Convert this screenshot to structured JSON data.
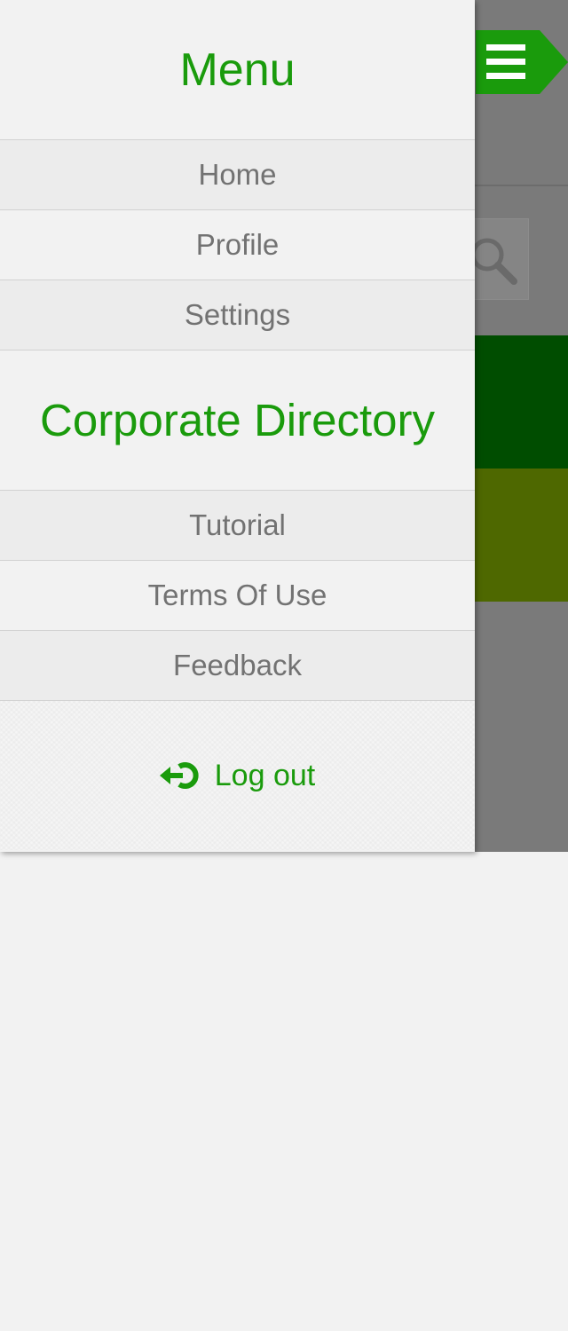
{
  "menu": {
    "title": "Menu",
    "items_top": [
      {
        "label": "Home"
      },
      {
        "label": "Profile"
      },
      {
        "label": "Settings"
      }
    ],
    "section_heading": "Corporate Directory",
    "items_bottom": [
      {
        "label": "Tutorial"
      },
      {
        "label": "Terms Of Use"
      },
      {
        "label": "Feedback"
      }
    ],
    "logout": {
      "label": "Log out",
      "icon": "logout-icon"
    }
  },
  "background_app": {
    "menu_toggle_icon": "hamburger-icon",
    "search_icon": "search-icon"
  },
  "colors": {
    "accent": "#1a9b0c",
    "overlay": "#7a7a7a",
    "band_dark": "#004d00",
    "band_olive": "#4e6800",
    "text_muted": "#727272"
  }
}
